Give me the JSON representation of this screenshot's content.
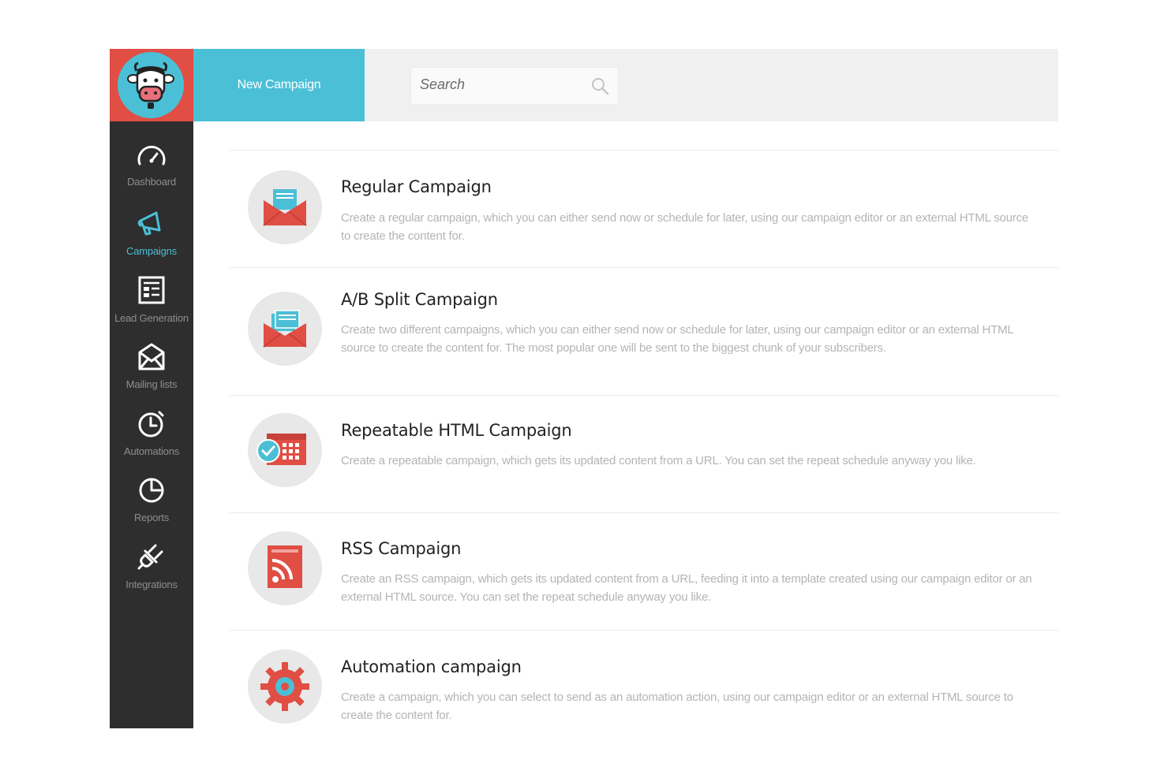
{
  "header": {
    "new_campaign_label": "New Campaign",
    "search_placeholder": "Search"
  },
  "sidebar": {
    "items": [
      {
        "label": "Dashboard",
        "icon": "speedometer-icon"
      },
      {
        "label": "Campaigns",
        "icon": "megaphone-icon",
        "active": true
      },
      {
        "label": "Lead Generation",
        "icon": "form-icon"
      },
      {
        "label": "Mailing lists",
        "icon": "envelope-icon"
      },
      {
        "label": "Automations",
        "icon": "stopwatch-icon"
      },
      {
        "label": "Reports",
        "icon": "pie-chart-icon"
      },
      {
        "label": "Integrations",
        "icon": "plug-icon"
      }
    ]
  },
  "campaigns": [
    {
      "title": "Regular Campaign",
      "description": "Create a regular campaign, which you can either send now or schedule for later, using our campaign editor or an external HTML source to create the content for.",
      "icon": "envelope-icon"
    },
    {
      "title": "A/B Split Campaign",
      "description": "Create two different campaigns, which you can either send now or schedule for later, using our campaign editor or an external HTML source to create the content for. The most popular one will be sent to the biggest chunk of your subscribers.",
      "icon": "split-envelope-icon"
    },
    {
      "title": "Repeatable HTML Campaign",
      "description": "Create a repeatable campaign, which gets its updated content from a URL. You can set the repeat schedule anyway you like.",
      "icon": "calendar-icon"
    },
    {
      "title": "RSS Campaign",
      "description": "Create an RSS campaign, which gets its updated content from a URL, feeding it into a template created using our campaign editor or an external HTML source. You can set the repeat schedule anyway you like.",
      "icon": "rss-icon"
    },
    {
      "title": "Automation campaign",
      "description": "Create a campaign, which you can select to send as an automation action, using our campaign editor or an external HTML source to create the content for.",
      "icon": "gear-icon"
    }
  ],
  "colors": {
    "accent": "#4bbfd6",
    "brand_red": "#e04e44",
    "sidebar_bg": "#2e2e2e",
    "header_bg": "#f0f0f0"
  }
}
